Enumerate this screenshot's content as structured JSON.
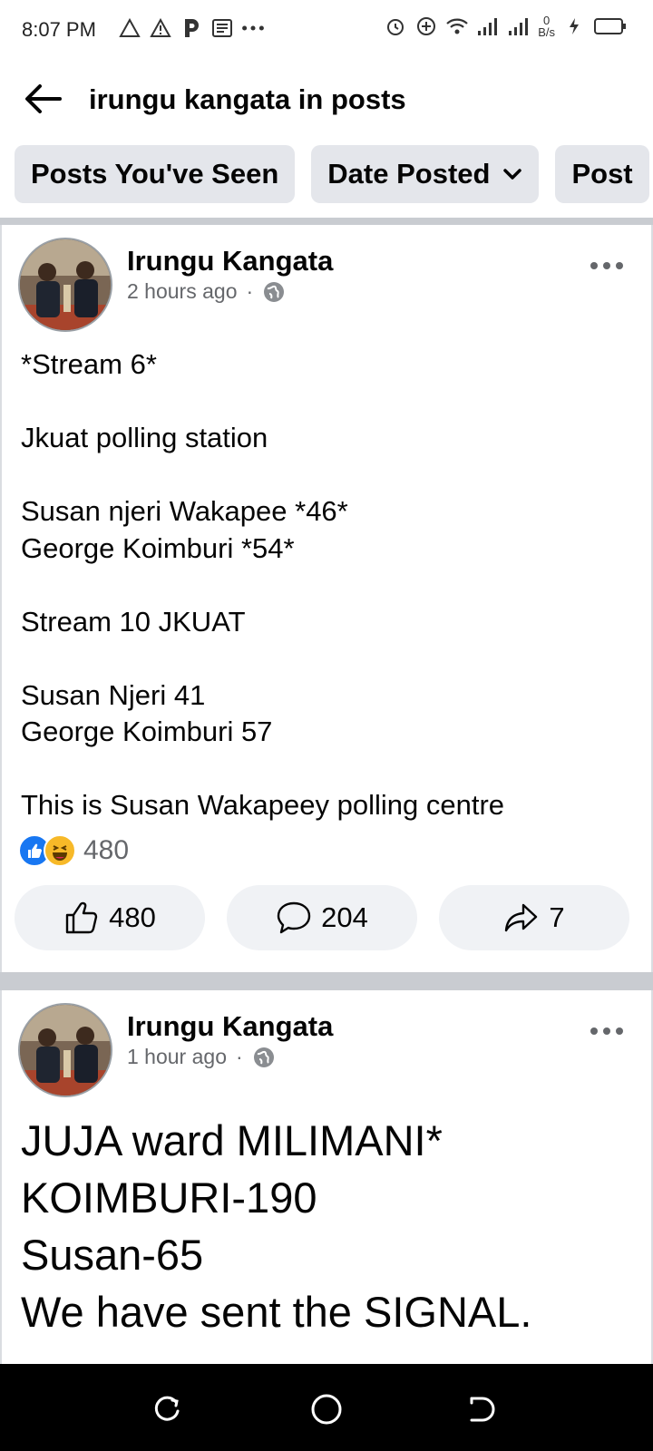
{
  "status_bar": {
    "time": "8:07 PM",
    "net_speed_value": "0",
    "net_speed_unit": "B/s",
    "left_icons": [
      "warning-outline-icon",
      "warning-icon",
      "parking-icon",
      "news-icon",
      "more-dots-icon"
    ],
    "right_icons": [
      "alarm-icon",
      "plus-circle-icon",
      "wifi-icon",
      "signal-icon",
      "signal-icon",
      "charging-icon",
      "battery-icon"
    ]
  },
  "header": {
    "title": "irungu kangata in posts",
    "back_icon": "arrow-left-icon"
  },
  "filters": [
    {
      "label": "Posts You've Seen",
      "has_dropdown": false
    },
    {
      "label": "Date Posted",
      "has_dropdown": true
    },
    {
      "label": "Post",
      "has_dropdown": false
    }
  ],
  "posts": [
    {
      "author": "Irungu Kangata",
      "time": "2 hours ago",
      "privacy_icon": "globe-icon",
      "body": "*Stream 6*\n\nJkuat polling station\n\nSusan njeri Wakapee *46*\nGeorge Koimburi *54*\n\nStream 10 JKUAT\n\nSusan Njeri 41\nGeorge Koimburi 57\n\nThis is Susan Wakapeey polling centre",
      "reaction_count": "480",
      "likes": "480",
      "comments": "204",
      "shares": "7"
    },
    {
      "author": "Irungu Kangata",
      "time": "1 hour ago",
      "privacy_icon": "globe-icon",
      "body": "JUJA ward  MILIMANI*\nKOIMBURI-190\nSusan-65\nWe have sent the SIGNAL."
    }
  ],
  "colors": {
    "chip_bg": "#e4e6eb",
    "action_bg": "#f0f2f5",
    "meta_text": "#65676b",
    "like_blue": "#1877f2",
    "haha_yellow": "#f7b928",
    "separator": "#c9ccd1"
  }
}
